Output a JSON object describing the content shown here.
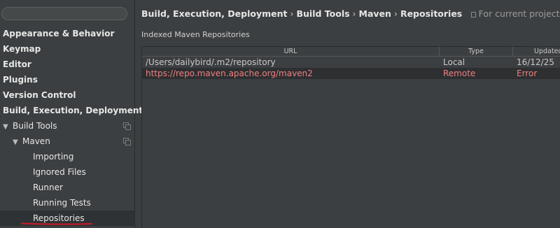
{
  "search": {
    "placeholder": ""
  },
  "sidebar": {
    "items": [
      {
        "label": "Appearance & Behavior"
      },
      {
        "label": "Keymap"
      },
      {
        "label": "Editor"
      },
      {
        "label": "Plugins"
      },
      {
        "label": "Version Control"
      },
      {
        "label": "Build, Execution, Deployment"
      },
      {
        "label": "Build Tools",
        "arrow": "▼"
      },
      {
        "label": "Maven",
        "arrow": "▼"
      },
      {
        "label": "Importing"
      },
      {
        "label": "Ignored Files"
      },
      {
        "label": "Runner"
      },
      {
        "label": "Running Tests"
      },
      {
        "label": "Repositories"
      }
    ]
  },
  "breadcrumb": {
    "parts": [
      "Build, Execution, Deployment",
      "Build Tools",
      "Maven",
      "Repositories"
    ],
    "separator": "›",
    "note": "For current project"
  },
  "section_title": "Indexed Maven Repositories",
  "table": {
    "columns": [
      "URL",
      "Type",
      "Updated"
    ],
    "rows": [
      {
        "url": "/Users/dailybird/.m2/repository",
        "type": "Local",
        "updated": "16/12/25"
      },
      {
        "url": "https://repo.maven.apache.org/maven2",
        "type": "Remote",
        "updated": "Error"
      }
    ]
  },
  "colors": {
    "background": "#3c3f41",
    "error_text": "#f08080",
    "annotation_underline": "#d0192b"
  }
}
